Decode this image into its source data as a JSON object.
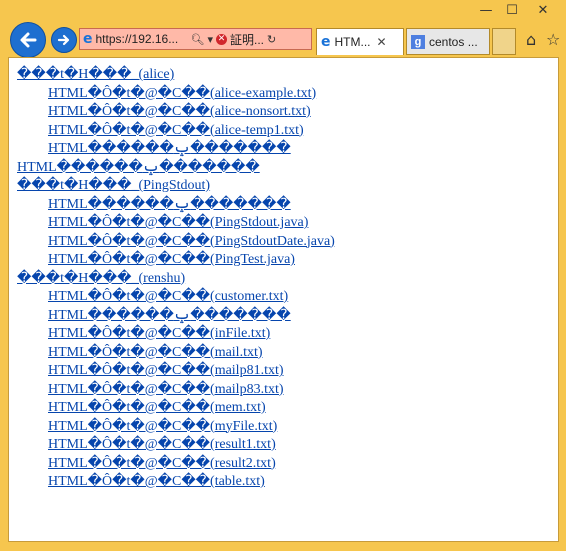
{
  "browser": {
    "address_url": "https://192.16...",
    "cert_label": "証明...",
    "tabs": [
      {
        "label": "HTM...",
        "active": true
      },
      {
        "label": "centos ...",
        "active": false
      }
    ]
  },
  "links": [
    {
      "text": "���t�H���_(alice)",
      "indent": false
    },
    {
      "text": "HTML�Ô�t�@�C��(alice-example.txt)",
      "indent": true
    },
    {
      "text": "HTML�Ô�t�@�C��(alice-nonsort.txt)",
      "indent": true
    },
    {
      "text": "HTML�Ô�t�@�C��(alice-temp1.txt)",
      "indent": true
    },
    {
      "text": "HTML������ݒ�������",
      "indent": true
    },
    {
      "text": "HTML������ݒ�������",
      "indent": false
    },
    {
      "text": "���t�H���_(PingStdout)",
      "indent": false
    },
    {
      "text": "HTML������ݒ�������",
      "indent": true
    },
    {
      "text": "HTML�Ô�t�@�C��(PingStdout.java)",
      "indent": true
    },
    {
      "text": "HTML�Ô�t�@�C��(PingStdoutDate.java)",
      "indent": true
    },
    {
      "text": "HTML�Ô�t�@�C��(PingTest.java)",
      "indent": true
    },
    {
      "text": "���t�H���_(renshu)",
      "indent": false
    },
    {
      "text": "HTML�Ô�t�@�C��(customer.txt)",
      "indent": true
    },
    {
      "text": "HTML������ݒ�������",
      "indent": true
    },
    {
      "text": "HTML�Ô�t�@�C��(inFile.txt)",
      "indent": true
    },
    {
      "text": "HTML�Ô�t�@�C��(mail.txt)",
      "indent": true
    },
    {
      "text": "HTML�Ô�t�@�C��(mailp81.txt)",
      "indent": true
    },
    {
      "text": "HTML�Ô�t�@�C��(mailp83.txt)",
      "indent": true
    },
    {
      "text": "HTML�Ô�t�@�C��(mem.txt)",
      "indent": true
    },
    {
      "text": "HTML�Ô�t�@�C��(myFile.txt)",
      "indent": true
    },
    {
      "text": "HTML�Ô�t�@�C��(result1.txt)",
      "indent": true
    },
    {
      "text": "HTML�Ô�t�@�C��(result2.txt)",
      "indent": true
    },
    {
      "text": "HTML�Ô�t�@�C��(table.txt)",
      "indent": true
    }
  ]
}
